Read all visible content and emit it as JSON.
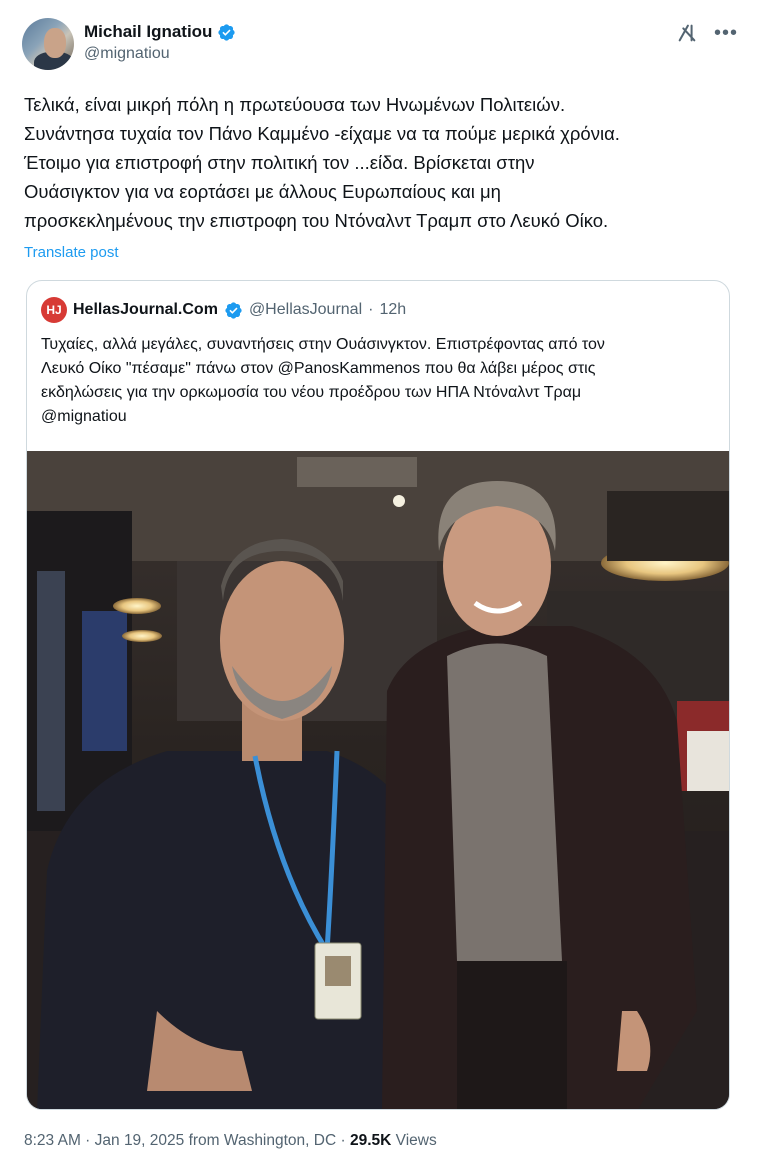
{
  "author": {
    "display_name": "Michail Ignatiou",
    "handle": "@mignatiou",
    "verified": true
  },
  "post": {
    "lines": [
      "Τελικά, είναι μικρή πόλη η πρωτεύουσα των Ηνωμένων Πολιτειών.",
      "Συνάντησα τυχαία τον Πάνο Καμμένο -είχαμε να τα πούμε μερικά χρόνια.",
      "Έτοιμο για επιστροφή στην πολιτική τον ...είδα. Βρίσκεται στην",
      "Ουάσιγκτον για να εορτάσει με άλλους Ευρωπαίους και μη",
      "προσκεκλημένους την επιστροφη του Ντόναλντ Τραμπ στο Λευκό Οίκο."
    ],
    "translate_label": "Translate post"
  },
  "quote": {
    "logo_text": "HJ",
    "display_name": "HellasJournal.Com",
    "handle": "@HellasJournal",
    "separator": "·",
    "time": "12h",
    "lines": [
      "Τυχαίες, αλλά μεγάλες, συναντήσεις στην Ουάσινγκτον. Επιστρέφοντας από τον",
      "Λευκό Οίκο \"πέσαμε\" πάνω στον @PanosKammenos που θα λάβει μέρος στις",
      "εκδηλώσεις για την ορκωμοσία του νέου προέδρου των ΗΠΑ Ντόναλντ Τραμ",
      "@mignatiou"
    ]
  },
  "footer": {
    "timestamp": "8:23 AM · Jan 19, 2025 from Washington, DC · ",
    "views_count": "29.5K",
    "views_label": " Views"
  },
  "icons": [
    "verified-badge-icon",
    "grok-icon",
    "more-icon",
    "verified-badge-icon"
  ],
  "colors": {
    "accent": "#1d9bf0",
    "secondary_text": "#536471",
    "logo_red": "#d73a35"
  }
}
